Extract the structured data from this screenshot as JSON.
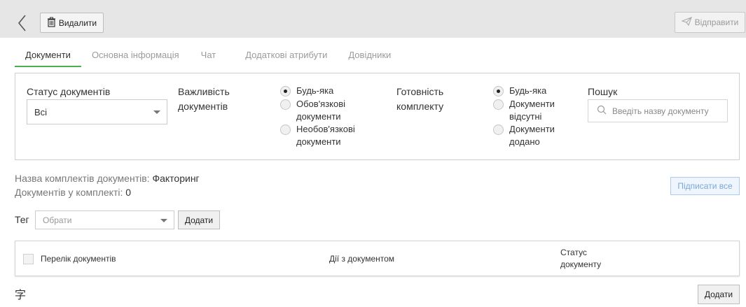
{
  "toolbar": {
    "delete_label": "Видалити",
    "send_label": "Відправити"
  },
  "tabs": [
    {
      "label": "Документи",
      "active": true
    },
    {
      "label": "Основна інформація",
      "active": false
    },
    {
      "label": "Чат",
      "active": false
    },
    {
      "label": "Додаткові атрибути",
      "active": false
    },
    {
      "label": "Довідники",
      "active": false
    }
  ],
  "filters": {
    "status_label": "Статус документів",
    "status_value": "Всі",
    "importance_label_1": "Важливість",
    "importance_label_2": "документів",
    "importance_options": [
      {
        "line1": "Будь-яка",
        "line2": "",
        "checked": true
      },
      {
        "line1": "Обов'язкові",
        "line2": "документи",
        "checked": false
      },
      {
        "line1": "Необов'язкові",
        "line2": "документи",
        "checked": false
      }
    ],
    "readiness_label_1": "Готовність",
    "readiness_label_2": "комплекту",
    "readiness_options": [
      {
        "line1": "Будь-яка",
        "line2": "",
        "checked": true
      },
      {
        "line1": "Документи",
        "line2": "відсутні",
        "checked": false
      },
      {
        "line1": "Документи",
        "line2": "додано",
        "checked": false
      }
    ],
    "search_label": "Пошук",
    "search_placeholder": "Введіть назву документу"
  },
  "info": {
    "set_name_label": "Назва комплектів документів:",
    "set_name_value": "Факторинг",
    "docs_count_label": "Документів у комплекті:",
    "docs_count_value": "0"
  },
  "sign_all_label": "Підписати все",
  "tag": {
    "label": "Тег",
    "placeholder": "Обрати",
    "add_label": "Додати"
  },
  "table": {
    "col_docs": "Перелік документів",
    "col_actions": "Дії з документом",
    "col_status_1": "Статус",
    "col_status_2": "документу"
  },
  "footer": {
    "glyph": "字",
    "add_label": "Додати"
  },
  "colors": {
    "active_tab_underline": "#4caf50",
    "sign_all_border": "#aecbe8"
  }
}
